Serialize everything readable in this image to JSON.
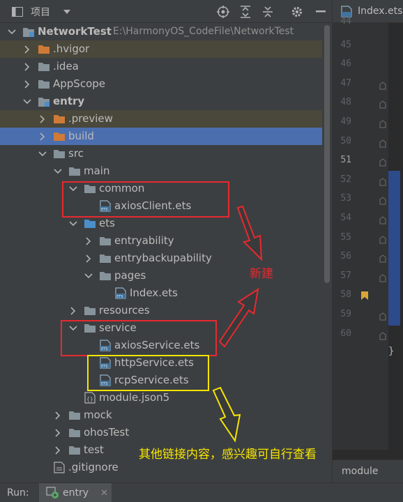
{
  "header": {
    "title": "项目",
    "icons": [
      "project-view-icon",
      "dropdown-icon",
      "locate-icon",
      "expand-all-icon",
      "collapse-all-icon",
      "settings-icon",
      "hide-icon"
    ]
  },
  "tree": [
    {
      "name": "NetworkTest",
      "path": "E:\\HarmonyOS_CodeFile\\NetworkTest",
      "kind": "module",
      "arrow": "down",
      "bold": true
    },
    {
      "name": ".hvigor",
      "kind": "folder-orange",
      "arrow": "right",
      "highlight": "yellow"
    },
    {
      "name": ".idea",
      "kind": "folder",
      "arrow": "right"
    },
    {
      "name": "AppScope",
      "kind": "folder",
      "arrow": "right"
    },
    {
      "name": "entry",
      "kind": "module",
      "arrow": "down",
      "bold": true
    },
    {
      "name": ".preview",
      "kind": "folder-orange",
      "arrow": "right",
      "highlight": "yellow"
    },
    {
      "name": "build",
      "kind": "folder-orange",
      "arrow": "right",
      "highlight": "blue"
    },
    {
      "name": "src",
      "kind": "folder",
      "arrow": "down"
    },
    {
      "name": "main",
      "kind": "folder",
      "arrow": "down"
    },
    {
      "name": "common",
      "kind": "folder",
      "arrow": "down"
    },
    {
      "name": "axiosClient.ets",
      "kind": "ets"
    },
    {
      "name": "ets",
      "kind": "folder-blue",
      "arrow": "down"
    },
    {
      "name": "entryability",
      "kind": "folder",
      "arrow": "right"
    },
    {
      "name": "entrybackupability",
      "kind": "folder",
      "arrow": "right"
    },
    {
      "name": "pages",
      "kind": "folder",
      "arrow": "down"
    },
    {
      "name": "Index.ets",
      "kind": "ets"
    },
    {
      "name": "resources",
      "kind": "folder",
      "arrow": "right"
    },
    {
      "name": "service",
      "kind": "folder",
      "arrow": "down"
    },
    {
      "name": "axiosService.ets",
      "kind": "ets"
    },
    {
      "name": "httpService.ets",
      "kind": "ets"
    },
    {
      "name": "rcpService.ets",
      "kind": "ets"
    },
    {
      "name": "module.json5",
      "kind": "json"
    },
    {
      "name": "mock",
      "kind": "folder",
      "arrow": "right"
    },
    {
      "name": "ohosTest",
      "kind": "folder",
      "arrow": "right"
    },
    {
      "name": "test",
      "kind": "folder",
      "arrow": "right"
    },
    {
      "name": ".gitignore",
      "kind": "file"
    }
  ],
  "editor": {
    "tab_label": "Index.ets",
    "line_numbers": [
      "44",
      "45",
      "46",
      "47",
      "48",
      "49",
      "50",
      "51",
      "52",
      "53",
      "54",
      "55",
      "56",
      "57",
      "58",
      "59",
      "60"
    ],
    "current_line": "51",
    "code_fragment": "}",
    "breadcrumb": "module"
  },
  "run_bar": {
    "label": "Run:",
    "tab_label": "entry"
  },
  "annotations": {
    "new_label": "新建",
    "other_label": "其他链接内容，感兴趣可自行查看"
  },
  "colors": {
    "panel_bg": "#3c3f41",
    "editor_bg": "#2b2b2b",
    "selection_blue": "#4b6eaf",
    "excluded_yellow": "#4a473b",
    "annotation_red": "#e8292f",
    "annotation_yellow": "#f7e600"
  }
}
